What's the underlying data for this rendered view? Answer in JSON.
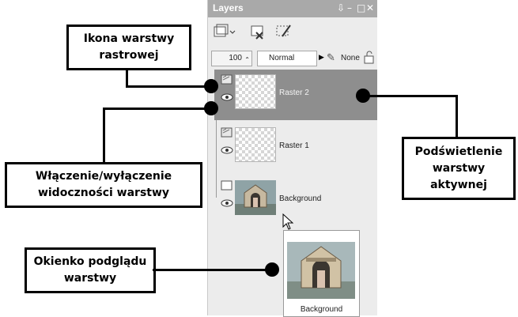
{
  "palette": {
    "title": "Layers",
    "opacity_value": "100",
    "blend_mode": "Normal",
    "mask_value": "None"
  },
  "layers": [
    {
      "name": "Raster 2",
      "active": true
    },
    {
      "name": "Raster 1",
      "active": false
    },
    {
      "name": "Background",
      "active": false
    }
  ],
  "callouts": {
    "raster_icon": [
      "Ikona warstwy",
      "rastrowej"
    ],
    "visibility": [
      "Włączenie/wyłączenie",
      "widoczności warstwy"
    ],
    "preview": [
      "Okienko podglądu",
      "warstwy"
    ],
    "highlight": [
      "Podświetlenie",
      "warstwy",
      "aktywnej"
    ]
  },
  "preview": {
    "label": "Background"
  },
  "colors": {
    "active_row": "#8e8e8e",
    "title_bar": "#a9a9a9"
  }
}
